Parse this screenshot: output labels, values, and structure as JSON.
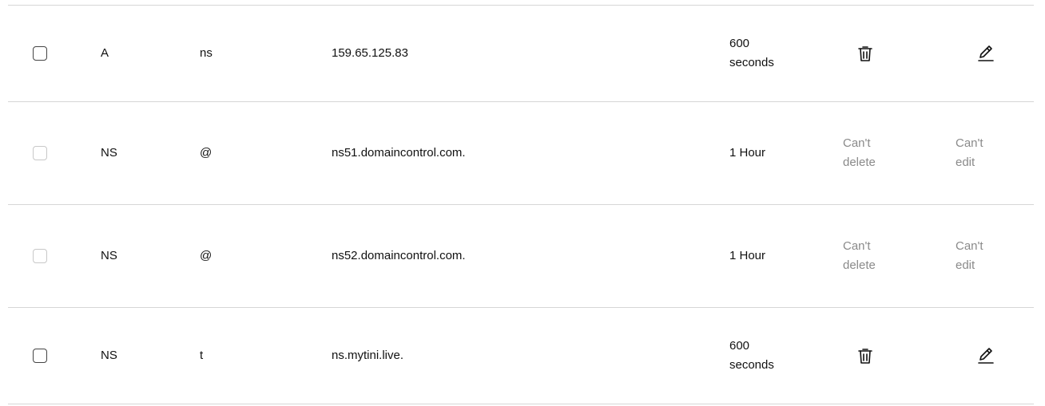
{
  "rows": [
    {
      "type": "A",
      "name": "ns",
      "data": "159.65.125.83",
      "ttl_line1": "600",
      "ttl_line2": "seconds",
      "deletable": true,
      "editable": true
    },
    {
      "type": "NS",
      "name": "@",
      "data": "ns51.domaincontrol.com.",
      "ttl_line1": "1 Hour",
      "ttl_line2": "",
      "deletable": false,
      "editable": false,
      "delete_line1": "Can't",
      "delete_line2": "delete",
      "edit_line1": "Can't",
      "edit_line2": "edit"
    },
    {
      "type": "NS",
      "name": "@",
      "data": "ns52.domaincontrol.com.",
      "ttl_line1": "1 Hour",
      "ttl_line2": "",
      "deletable": false,
      "editable": false,
      "delete_line1": "Can't",
      "delete_line2": "delete",
      "edit_line1": "Can't",
      "edit_line2": "edit"
    },
    {
      "type": "NS",
      "name": "t",
      "data": "ns.mytini.live.",
      "ttl_line1": "600",
      "ttl_line2": "seconds",
      "deletable": true,
      "editable": true
    }
  ],
  "icons": {
    "delete": "trash-icon",
    "edit": "pencil-icon"
  }
}
